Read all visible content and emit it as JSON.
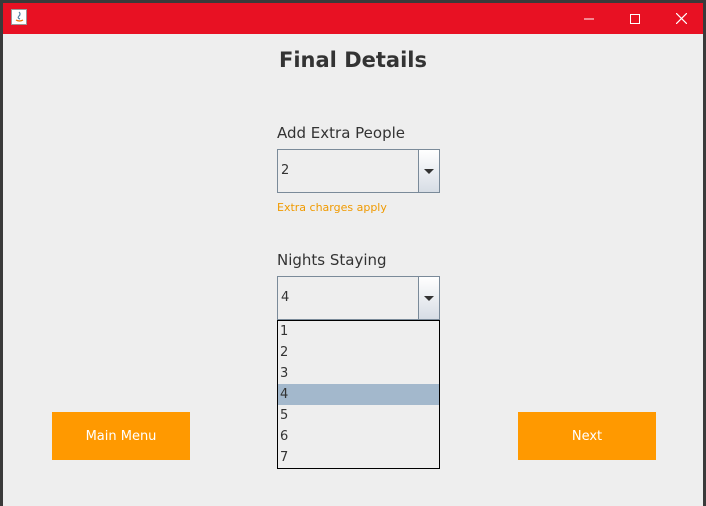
{
  "window": {
    "controls": {
      "minimize": "minimize-icon",
      "maximize": "maximize-icon",
      "close": "close-icon"
    },
    "app_icon": "java-icon",
    "colors": {
      "titlebar": "#e81123",
      "accent": "#ff9900",
      "note": "#f09a00",
      "selection": "#a3b8cc"
    }
  },
  "page": {
    "title": "Final Details"
  },
  "extra_people": {
    "label": "Add Extra People",
    "value": "2",
    "note": "Extra charges apply"
  },
  "nights": {
    "label": "Nights Staying",
    "value": "4",
    "options": [
      "1",
      "2",
      "3",
      "4",
      "5",
      "6",
      "7"
    ],
    "selected_index": 3
  },
  "buttons": {
    "main_menu": "Main Menu",
    "next": "Next"
  }
}
